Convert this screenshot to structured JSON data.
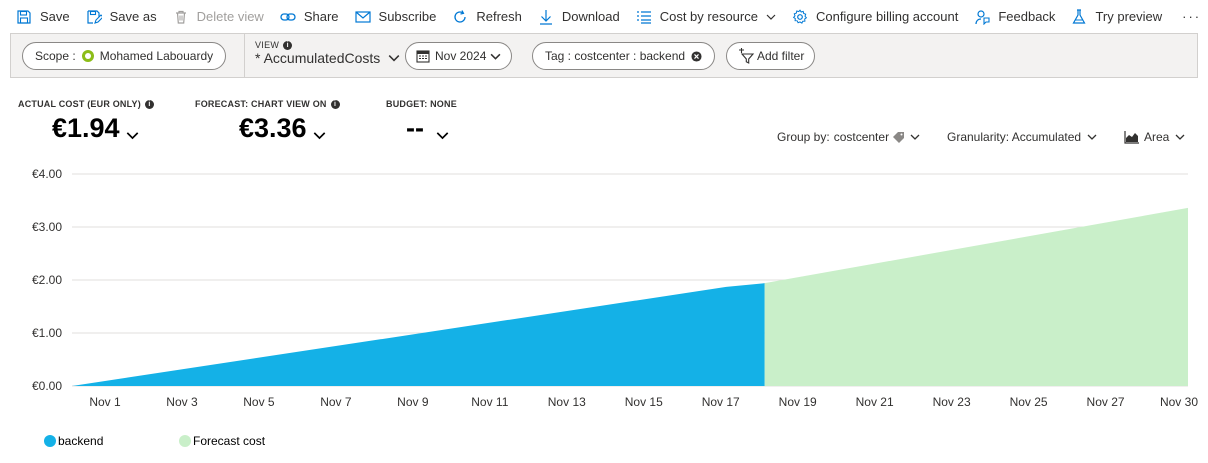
{
  "toolbar": {
    "save": "Save",
    "save_as": "Save as",
    "delete_view": "Delete view",
    "share": "Share",
    "subscribe": "Subscribe",
    "refresh": "Refresh",
    "download": "Download",
    "cost_by_resource": "Cost by resource",
    "configure_billing": "Configure billing account",
    "feedback": "Feedback",
    "try_preview": "Try preview",
    "more": "···"
  },
  "filters": {
    "scope_label": "Scope :",
    "scope_value": "Mohamed Labouardy",
    "view_caption": "VIEW",
    "view_name": "* AccumulatedCosts",
    "date": "Nov 2024",
    "tag": "Tag : costcenter : backend",
    "add_filter": "Add filter"
  },
  "kpis": {
    "actual_caption": "ACTUAL COST (EUR ONLY)",
    "actual_value": "€1.94",
    "forecast_caption": "FORECAST: CHART VIEW ON",
    "forecast_value": "€3.36",
    "budget_caption": "BUDGET: NONE",
    "budget_value": "--"
  },
  "controls": {
    "group_by_label": "Group by:",
    "group_by_value": "costcenter",
    "granularity": "Granularity: Accumulated",
    "chart_type": "Area"
  },
  "colors": {
    "actual": "#14b1e7",
    "forecast": "#c9efc9",
    "accent": "#0078d4"
  },
  "chart_data": {
    "type": "area",
    "y_tick_labels": [
      "€0.00",
      "€1.00",
      "€2.00",
      "€3.00",
      "€4.00"
    ],
    "ylim": [
      0,
      4
    ],
    "x_tick_labels": [
      "Nov 1",
      "Nov 3",
      "Nov 5",
      "Nov 7",
      "Nov 9",
      "Nov 11",
      "Nov 13",
      "Nov 15",
      "Nov 17",
      "Nov 19",
      "Nov 21",
      "Nov 23",
      "Nov 25",
      "Nov 27",
      "Nov 30"
    ],
    "xlim": [
      1,
      30
    ],
    "series": [
      {
        "name": "backend",
        "x": [
          1,
          18,
          19
        ],
        "values": [
          0,
          1.87,
          1.94
        ]
      },
      {
        "name": "Forecast cost",
        "x": [
          19,
          30
        ],
        "values": [
          1.94,
          3.36
        ]
      }
    ],
    "grid": true,
    "legend_position": "bottom-left"
  }
}
